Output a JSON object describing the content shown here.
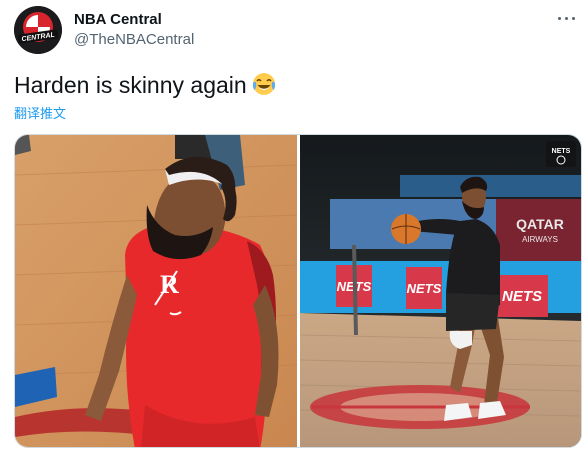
{
  "author": {
    "display_name": "NBA Central",
    "handle": "@TheNBACentral",
    "avatar_text": "CENTRAL"
  },
  "tweet": {
    "text": "Harden is skinny again",
    "emoji": "face-with-tears-of-joy",
    "translate_label": "翻译推文"
  },
  "media": {
    "left_photo": {
      "jersey_text": "R"
    },
    "right_photo": {
      "ad_boards": [
        "NETS",
        "NETS",
        "NETS"
      ],
      "sponsor_line1": "QATAR",
      "sponsor_line2": "AIRWAYS",
      "watermark": "NETS"
    }
  },
  "colors": {
    "link": "#1d9bf0",
    "secondary_text": "#536471",
    "primary_text": "#0f1419"
  }
}
